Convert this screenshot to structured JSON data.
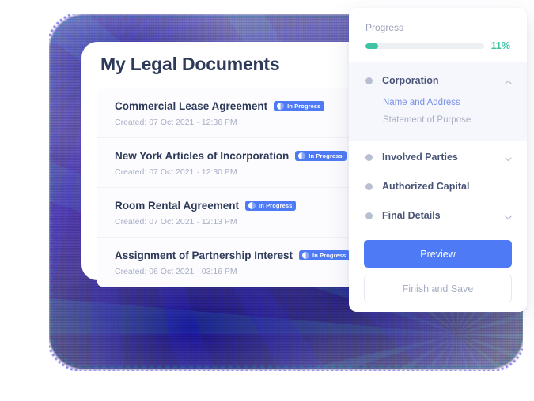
{
  "documents_card": {
    "title": "My Legal Documents",
    "meta_prefix": "Created:",
    "items": [
      {
        "name": "Commercial Lease Agreement",
        "status": "In Progress",
        "status_icon": "half-circle-icon",
        "created": "Created: 07 Oct 2021 · 12:36 PM"
      },
      {
        "name": "New York Articles of Incorporation",
        "status": "In Progress",
        "status_icon": "half-circle-icon",
        "created": "Created: 07 Oct 2021 · 12:30 PM"
      },
      {
        "name": "Room Rental Agreement",
        "status": "In Progress",
        "status_icon": "half-circle-icon",
        "created": "Created: 07 Oct 2021 · 12:13 PM"
      },
      {
        "name": "Assignment of Partnership Interest",
        "status": "In Progress",
        "status_icon": "half-circle-icon",
        "created": "Created: 06 Oct 2021 · 03:16 PM"
      }
    ]
  },
  "side_panel": {
    "progress": {
      "label": "Progress",
      "percent_text": "11%",
      "percent_value": 11,
      "fill_color": "#3ec3a5",
      "track_color": "#ecf0f2"
    },
    "sections": [
      {
        "label": "Corporation",
        "expanded": true,
        "chevron": "chevron-up-icon",
        "dot": "step-dot-icon",
        "children": [
          {
            "label": "Name and Address",
            "selected": true
          },
          {
            "label": "Statement of Purpose",
            "selected": false
          }
        ]
      },
      {
        "label": "Involved Parties",
        "expanded": false,
        "chevron": "chevron-down-icon",
        "dot": "step-dot-icon",
        "children": []
      },
      {
        "label": "Authorized Capital",
        "expanded": false,
        "chevron": "none",
        "dot": "step-dot-icon",
        "children": []
      },
      {
        "label": "Final Details",
        "expanded": false,
        "chevron": "chevron-down-icon",
        "dot": "step-dot-icon",
        "children": []
      }
    ],
    "buttons": {
      "primary_label": "Preview",
      "secondary_label": "Finish and Save",
      "primary_color": "#4e7bf5"
    }
  },
  "theme": {
    "badge_color": "#4e7bf5",
    "heading_color": "#2e3a59",
    "muted_color": "#a7adc4",
    "accent_teal": "#3ec3a5",
    "active_section_bg": "#f6f7fd"
  }
}
